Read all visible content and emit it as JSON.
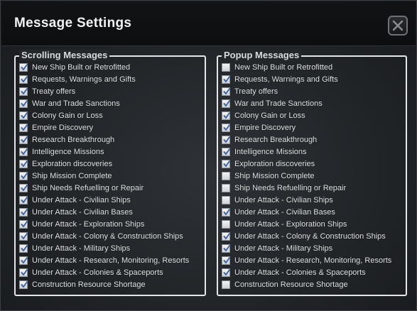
{
  "window": {
    "title": "Message Settings"
  },
  "scrolling": {
    "legend": "Scrolling Messages",
    "items": [
      {
        "label": "New Ship Built or Retrofitted",
        "checked": true
      },
      {
        "label": "Requests, Warnings and Gifts",
        "checked": true
      },
      {
        "label": "Treaty offers",
        "checked": true
      },
      {
        "label": "War and Trade Sanctions",
        "checked": true
      },
      {
        "label": "Colony Gain or Loss",
        "checked": true
      },
      {
        "label": "Empire Discovery",
        "checked": true
      },
      {
        "label": "Research Breakthrough",
        "checked": true
      },
      {
        "label": "Intelligence Missions",
        "checked": true
      },
      {
        "label": "Exploration discoveries",
        "checked": true
      },
      {
        "label": "Ship Mission Complete",
        "checked": true
      },
      {
        "label": "Ship Needs Refuelling or Repair",
        "checked": true
      },
      {
        "label": "Under Attack - Civilian Ships",
        "checked": true
      },
      {
        "label": "Under Attack - Civilian Bases",
        "checked": true
      },
      {
        "label": "Under Attack - Exploration Ships",
        "checked": true
      },
      {
        "label": "Under Attack - Colony & Construction Ships",
        "checked": true
      },
      {
        "label": "Under Attack - Military Ships",
        "checked": true
      },
      {
        "label": "Under Attack - Research, Monitoring, Resorts",
        "checked": true
      },
      {
        "label": "Under Attack - Colonies & Spaceports",
        "checked": true
      },
      {
        "label": "Construction Resource Shortage",
        "checked": true
      }
    ]
  },
  "popup": {
    "legend": "Popup Messages",
    "items": [
      {
        "label": "New Ship Built or Retrofitted",
        "checked": false
      },
      {
        "label": "Requests, Warnings and Gifts",
        "checked": true
      },
      {
        "label": "Treaty offers",
        "checked": true
      },
      {
        "label": "War and Trade Sanctions",
        "checked": true
      },
      {
        "label": "Colony Gain or Loss",
        "checked": true
      },
      {
        "label": "Empire Discovery",
        "checked": true
      },
      {
        "label": "Research Breakthrough",
        "checked": true
      },
      {
        "label": "Intelligence Missions",
        "checked": true
      },
      {
        "label": "Exploration discoveries",
        "checked": true
      },
      {
        "label": "Ship Mission Complete",
        "checked": false
      },
      {
        "label": "Ship Needs Refuelling or Repair",
        "checked": false
      },
      {
        "label": "Under Attack - Civilian Ships",
        "checked": false
      },
      {
        "label": "Under Attack - Civilian Bases",
        "checked": true
      },
      {
        "label": "Under Attack - Exploration Ships",
        "checked": false
      },
      {
        "label": "Under Attack - Colony & Construction Ships",
        "checked": true
      },
      {
        "label": "Under Attack - Military Ships",
        "checked": true
      },
      {
        "label": "Under Attack - Research, Monitoring, Resorts",
        "checked": true
      },
      {
        "label": "Under Attack - Colonies & Spaceports",
        "checked": true
      },
      {
        "label": "Construction Resource Shortage",
        "checked": false
      }
    ]
  },
  "icons": {
    "close": "close-x-icon",
    "checkbox_tick": "check-icon"
  },
  "colors": {
    "background": "#24272a",
    "text": "#e3e4e5",
    "border": "#e4e6e8",
    "tick": "#3a5f9e"
  }
}
